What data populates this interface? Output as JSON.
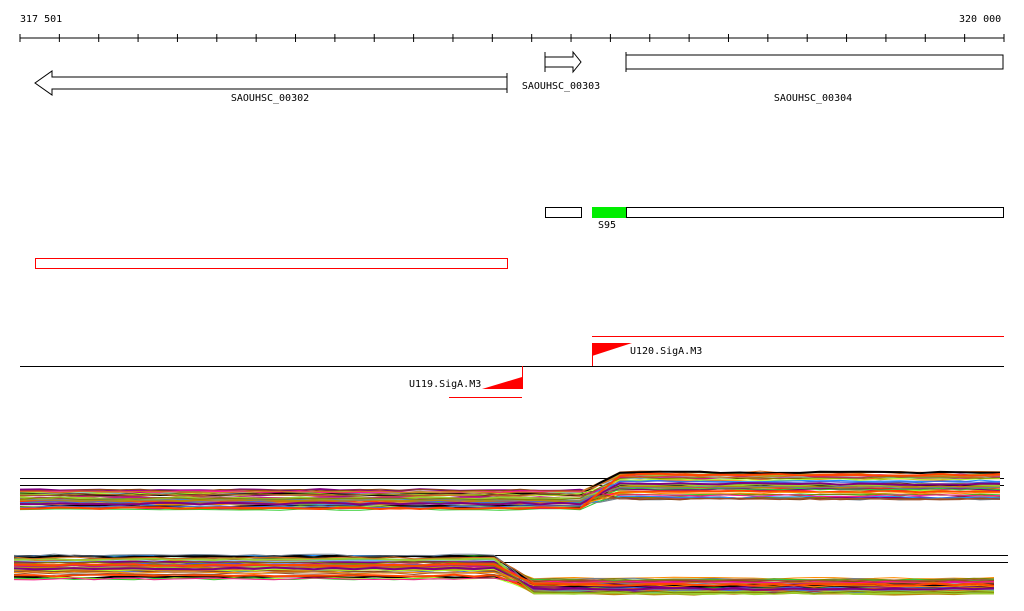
{
  "ruler": {
    "start_label": "317 501",
    "end_label": "320 000"
  },
  "genes": [
    {
      "name": "SAOUHSC_00302",
      "strand": "-"
    },
    {
      "name": "SAOUHSC_00303",
      "strand": "+"
    },
    {
      "name": "SAOUHSC_00304",
      "strand": "+"
    }
  ],
  "features": {
    "s95_label": "S95",
    "highlight_color": "#00ee00",
    "region_color": "#ff0000"
  },
  "promoters": [
    {
      "name": "U120.SigA.M3",
      "strand": "+"
    },
    {
      "name": "U119.SigA.M3",
      "strand": "-"
    }
  ],
  "profile_colors": [
    "#800080",
    "#808000",
    "#d2691e",
    "#ff4500",
    "#1e90ff",
    "#32cd32",
    "#c71585",
    "#8b4513",
    "#87ceeb",
    "#000000",
    "#ff1493",
    "#adff2f",
    "#b8860b",
    "#4169e1",
    "#a0522d",
    "#9acd32",
    "#ff8c00",
    "#708090"
  ]
}
